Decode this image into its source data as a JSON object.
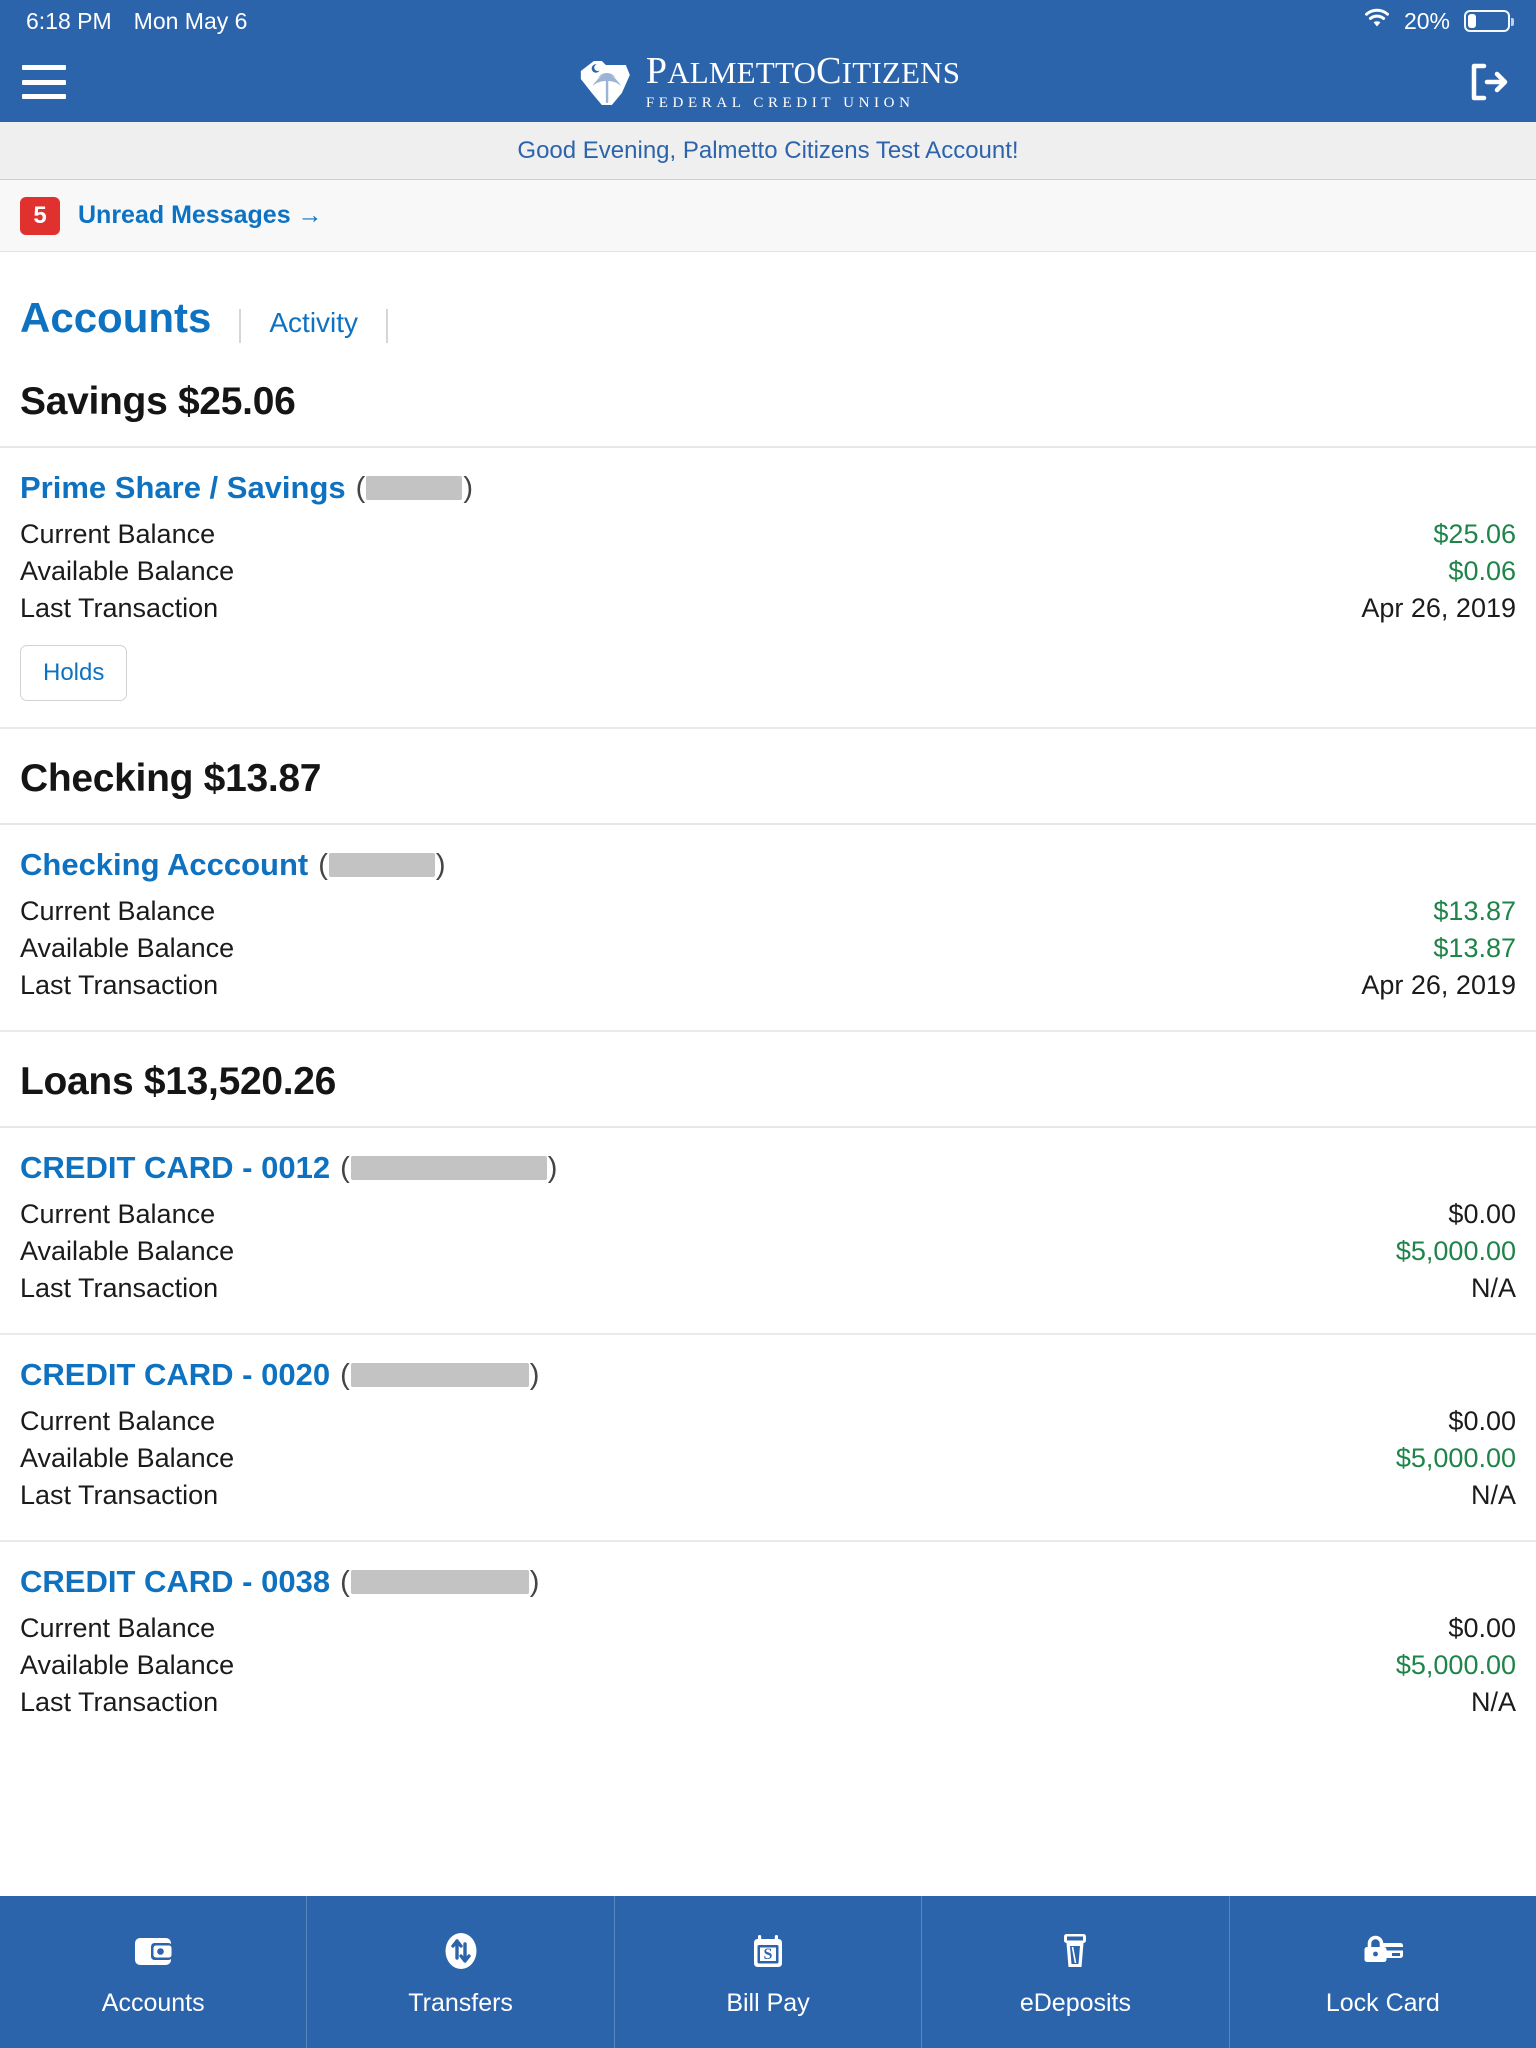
{
  "status_bar": {
    "time": "6:18 PM",
    "date": "Mon May 6",
    "battery_percent": "20%",
    "wifi_icon": "wifi-icon",
    "battery_icon": "battery-icon"
  },
  "header": {
    "menu_icon": "hamburger-menu-icon",
    "logo_name_part1": "P",
    "logo_name_part2": "ALMETTO",
    "logo_name_part3": "C",
    "logo_name_part4": "ITIZENS",
    "logo_subtitle": "FEDERAL CREDIT UNION",
    "logout_icon": "logout-icon",
    "background_color": "#2c64ac"
  },
  "greeting": {
    "text": "Good Evening, Palmetto Citizens Test Account!"
  },
  "messages": {
    "count": "5",
    "label": "Unread Messages →",
    "badge_color": "#e0312e"
  },
  "tabs": {
    "primary": "Accounts",
    "secondary": "Activity"
  },
  "labels": {
    "current_balance": "Current Balance",
    "available_balance": "Available Balance",
    "last_transaction": "Last Transaction",
    "holds": "Holds"
  },
  "groups": [
    {
      "title": "Savings $25.06",
      "accounts": [
        {
          "name": "Prime Share / Savings",
          "masked_width": 96,
          "current_balance": "$25.06",
          "current_balance_color": "green",
          "available_balance": "$0.06",
          "available_balance_color": "green",
          "last_transaction": "Apr 26, 2019",
          "has_holds": true
        }
      ]
    },
    {
      "title": "Checking $13.87",
      "accounts": [
        {
          "name": "Checking Acccount",
          "masked_width": 106,
          "current_balance": "$13.87",
          "current_balance_color": "green",
          "available_balance": "$13.87",
          "available_balance_color": "green",
          "last_transaction": "Apr 26, 2019",
          "has_holds": false
        }
      ]
    },
    {
      "title": "Loans $13,520.26",
      "accounts": [
        {
          "name": "CREDIT CARD - 0012",
          "masked_width": 196,
          "current_balance": "$0.00",
          "current_balance_color": "dark",
          "available_balance": "$5,000.00",
          "available_balance_color": "green",
          "last_transaction": "N/A",
          "has_holds": false
        },
        {
          "name": "CREDIT CARD - 0020",
          "masked_width": 178,
          "current_balance": "$0.00",
          "current_balance_color": "dark",
          "available_balance": "$5,000.00",
          "available_balance_color": "green",
          "last_transaction": "N/A",
          "has_holds": false
        },
        {
          "name": "CREDIT CARD - 0038",
          "masked_width": 178,
          "current_balance": "$0.00",
          "current_balance_color": "dark",
          "available_balance": "$5,000.00",
          "available_balance_color": "green",
          "last_transaction": "N/A",
          "has_holds": false
        }
      ]
    }
  ],
  "bottom_nav": {
    "background_color": "#2c64ac",
    "items": [
      {
        "label": "Accounts",
        "icon": "wallet-icon"
      },
      {
        "label": "Transfers",
        "icon": "transfer-arrows-icon"
      },
      {
        "label": "Bill Pay",
        "icon": "calendar-dollar-icon"
      },
      {
        "label": "eDeposits",
        "icon": "check-deposit-icon"
      },
      {
        "label": "Lock Card",
        "icon": "lock-card-icon"
      }
    ]
  }
}
